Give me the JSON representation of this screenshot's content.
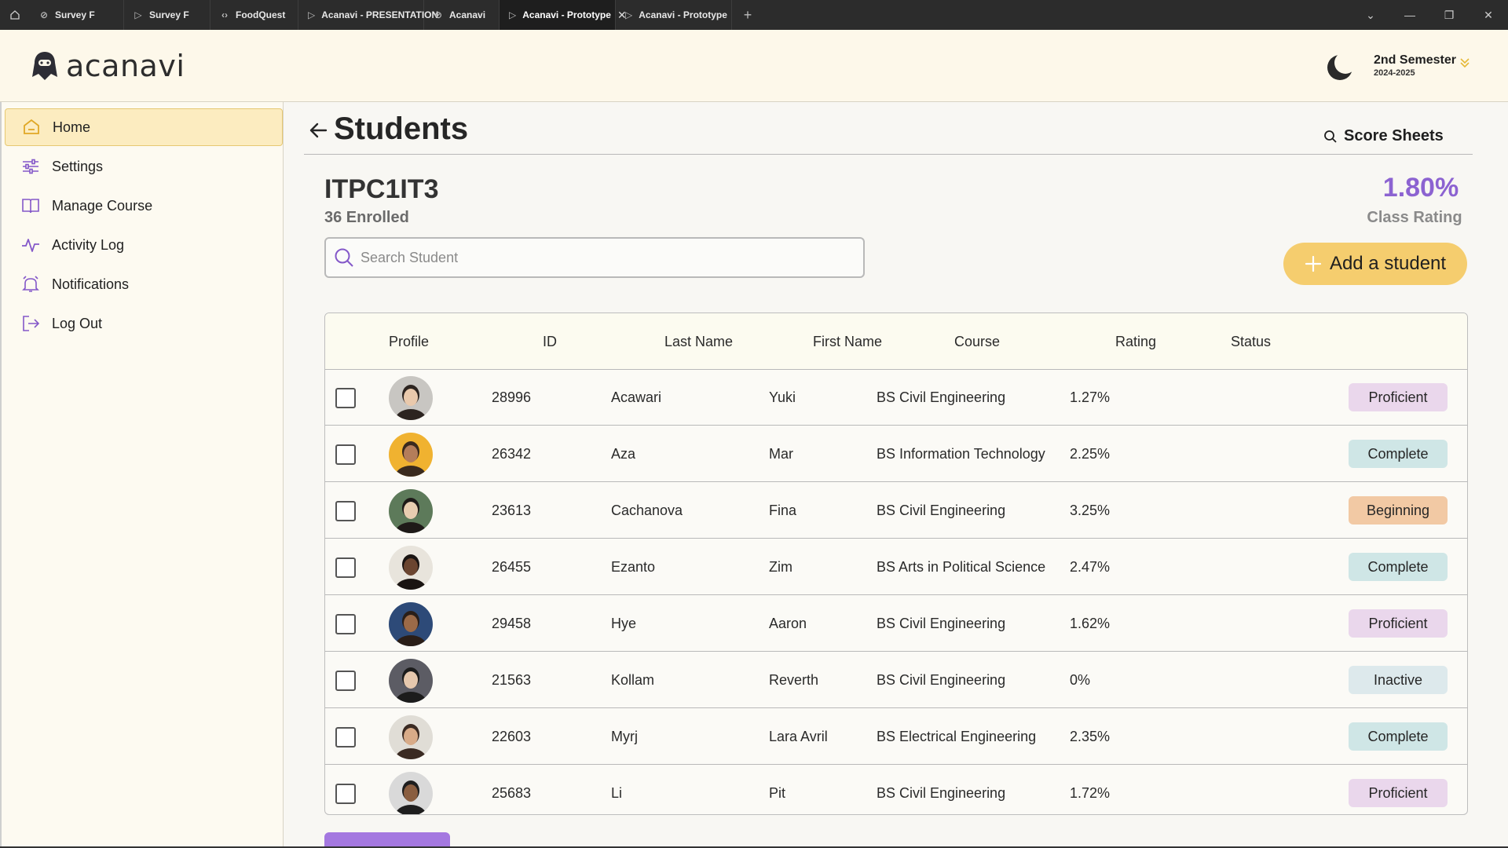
{
  "browser": {
    "tabs": [
      {
        "label": "Survey F",
        "icon": "figma-icon"
      },
      {
        "label": "Survey F",
        "icon": "play-icon"
      },
      {
        "label": "FoodQuest",
        "icon": "code-icon"
      },
      {
        "label": "Acanavi - PRESENTATION",
        "icon": "play-icon"
      },
      {
        "label": "Acanavi",
        "icon": "figma-icon"
      },
      {
        "label": "Acanavi - Prototype",
        "icon": "play-icon",
        "active": true
      },
      {
        "label": "Acanavi - Prototype",
        "icon": "play-icon"
      }
    ],
    "new_tab": "+"
  },
  "app": {
    "logo_text": "acanavi",
    "semester": {
      "name": "2nd Semester",
      "year": "2024-2025"
    }
  },
  "sidebar": {
    "items": [
      {
        "label": "Home",
        "icon": "home-icon",
        "active": true
      },
      {
        "label": "Settings",
        "icon": "sliders-icon"
      },
      {
        "label": "Manage Course",
        "icon": "book-icon"
      },
      {
        "label": "Activity Log",
        "icon": "activity-icon"
      },
      {
        "label": "Notifications",
        "icon": "bell-icon"
      },
      {
        "label": "Log Out",
        "icon": "logout-icon"
      }
    ]
  },
  "main": {
    "title": "Students",
    "score_sheets": "Score Sheets",
    "course_code": "ITPC1IT3",
    "enrolled": "36 Enrolled",
    "search_placeholder": "Search Student",
    "class_rating_value": "1.80%",
    "class_rating_label": "Class Rating",
    "add_button": "Add a student"
  },
  "table": {
    "headers": [
      "Profile",
      "ID",
      "Last Name",
      "First Name",
      "Course",
      "Rating",
      "Status"
    ],
    "rows": [
      {
        "id": "28996",
        "last": "Acawari",
        "first": "Yuki",
        "course": "BS Civil Engineering",
        "rating": "1.27%",
        "status": "Proficient"
      },
      {
        "id": "26342",
        "last": "Aza",
        "first": "Mar",
        "course": "BS Information Technology",
        "rating": "2.25%",
        "status": "Complete"
      },
      {
        "id": "23613",
        "last": "Cachanova",
        "first": "Fina",
        "course": "BS Civil Engineering",
        "rating": "3.25%",
        "status": "Beginning"
      },
      {
        "id": "26455",
        "last": "Ezanto",
        "first": "Zim",
        "course": "BS Arts in Political Science",
        "rating": "2.47%",
        "status": "Complete"
      },
      {
        "id": "29458",
        "last": "Hye",
        "first": "Aaron",
        "course": "BS Civil Engineering",
        "rating": "1.62%",
        "status": "Proficient"
      },
      {
        "id": "21563",
        "last": "Kollam",
        "first": "Reverth",
        "course": "BS Civil Engineering",
        "rating": "0%",
        "status": "Inactive"
      },
      {
        "id": "22603",
        "last": "Myrj",
        "first": "Lara Avril",
        "course": "BS Electrical Engineering",
        "rating": "2.35%",
        "status": "Complete"
      },
      {
        "id": "25683",
        "last": "Li",
        "first": "Pit",
        "course": "BS Civil Engineering",
        "rating": "1.72%",
        "status": "Proficient"
      }
    ]
  },
  "status_colors": {
    "Proficient": "#ead7ec",
    "Complete": "#cfe6e6",
    "Beginning": "#f2c9a4",
    "Inactive": "#dde9ec"
  }
}
